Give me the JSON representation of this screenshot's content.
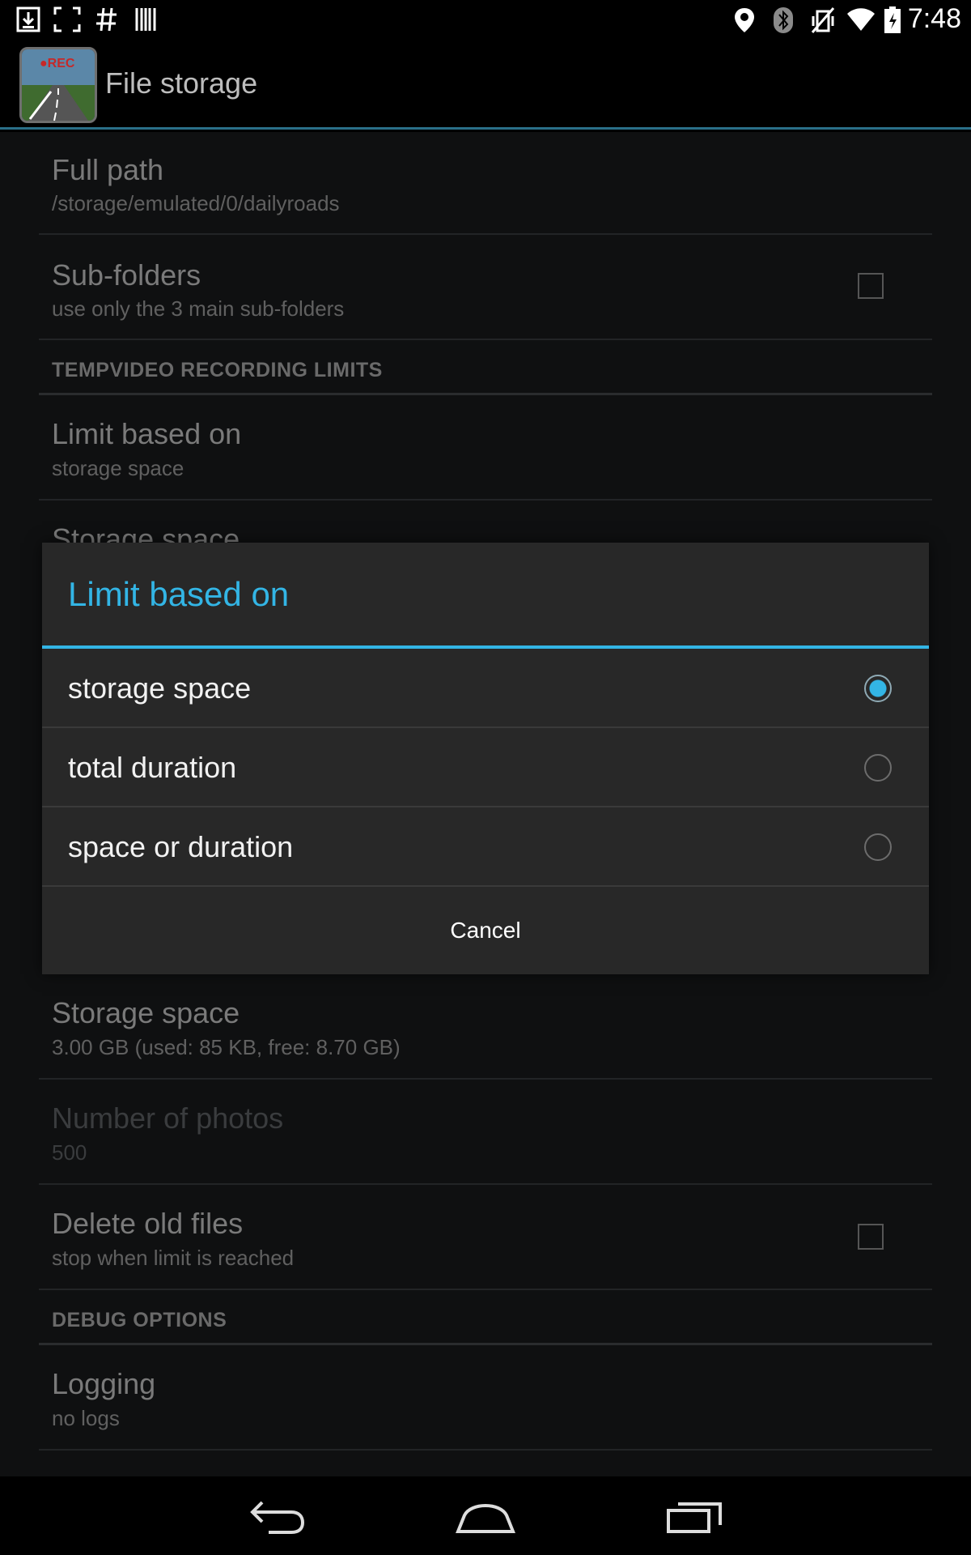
{
  "status_bar": {
    "time": "7:48",
    "left_icons": [
      "download-icon",
      "screenshot-icon",
      "hash-icon",
      "barcode-icon"
    ],
    "right_icons": [
      "location-icon",
      "bluetooth-icon",
      "vibrate-icon",
      "wifi-icon",
      "battery-icon"
    ]
  },
  "action_bar": {
    "title": "File storage",
    "app_icon_text": "●REC"
  },
  "preferences": {
    "full_path": {
      "title": "Full path",
      "summary": "/storage/emulated/0/dailyroads"
    },
    "sub_folders": {
      "title": "Sub-folders",
      "summary": "use only the 3 main sub-folders",
      "checked": false
    },
    "category_limits": "TEMPVIDEO RECORDING LIMITS",
    "limit_based_on": {
      "title": "Limit based on",
      "summary": "storage space"
    },
    "storage_space_peek": {
      "title": "Storage space"
    },
    "storage_space": {
      "title": "Storage space",
      "summary": "3.00 GB (used: 85 KB, free: 8.70 GB)"
    },
    "number_of_photos": {
      "title": "Number of photos",
      "summary": "500"
    },
    "delete_old_files": {
      "title": "Delete old files",
      "summary": "stop when limit is reached",
      "checked": false
    },
    "category_debug": "DEBUG OPTIONS",
    "logging": {
      "title": "Logging",
      "summary": "no logs"
    }
  },
  "dialog": {
    "title": "Limit based on",
    "options": [
      {
        "label": "storage space",
        "selected": true
      },
      {
        "label": "total duration",
        "selected": false
      },
      {
        "label": "space or duration",
        "selected": false
      }
    ],
    "cancel_label": "Cancel",
    "accent_color": "#33b5e5"
  },
  "nav_bar": {
    "icons": [
      "back-icon",
      "home-icon",
      "recent-apps-icon"
    ]
  }
}
